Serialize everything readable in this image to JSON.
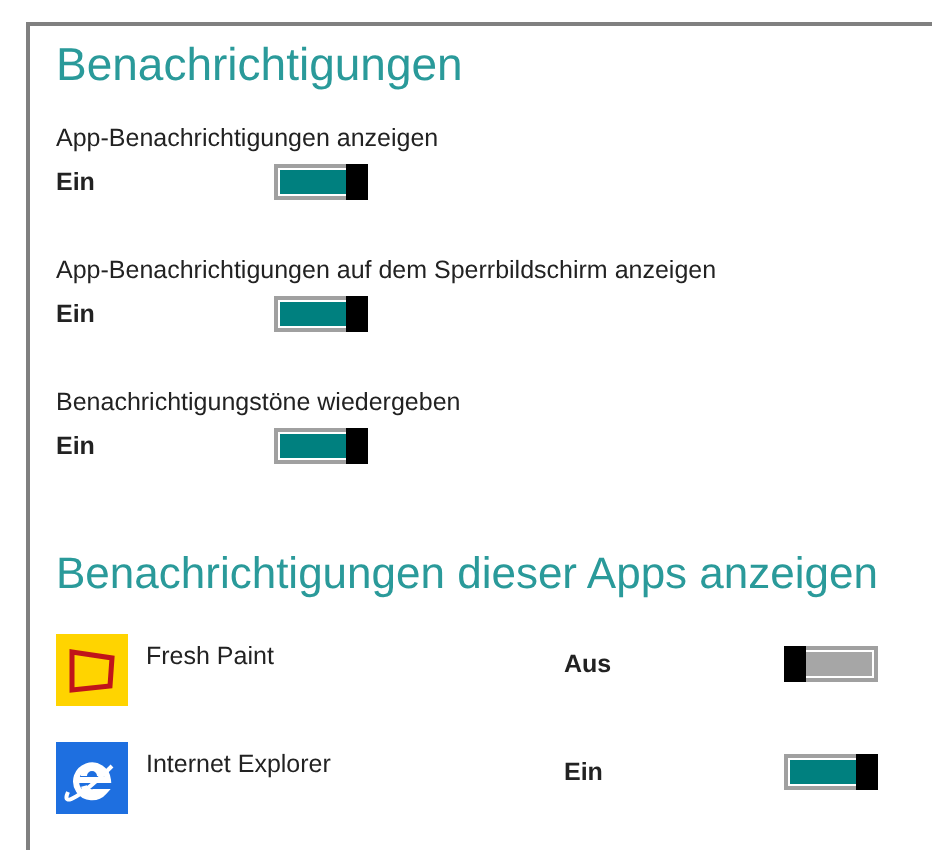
{
  "title": "Benachrichtigungen",
  "settings": [
    {
      "label": "App-Benachrichtigungen anzeigen",
      "state": "Ein",
      "on": true
    },
    {
      "label": "App-Benachrichtigungen auf dem Sperrbildschirm anzeigen",
      "state": "Ein",
      "on": true
    },
    {
      "label": "Benachrichtigungstöne wiedergeben",
      "state": "Ein",
      "on": true
    }
  ],
  "apps_section": {
    "title": "Benachrichtigungen dieser Apps anzeigen",
    "apps": [
      {
        "name": "Fresh Paint",
        "kind": "paint",
        "state": "Aus",
        "on": false
      },
      {
        "name": "Internet Explorer",
        "kind": "browser",
        "state": "Ein",
        "on": true
      }
    ]
  }
}
